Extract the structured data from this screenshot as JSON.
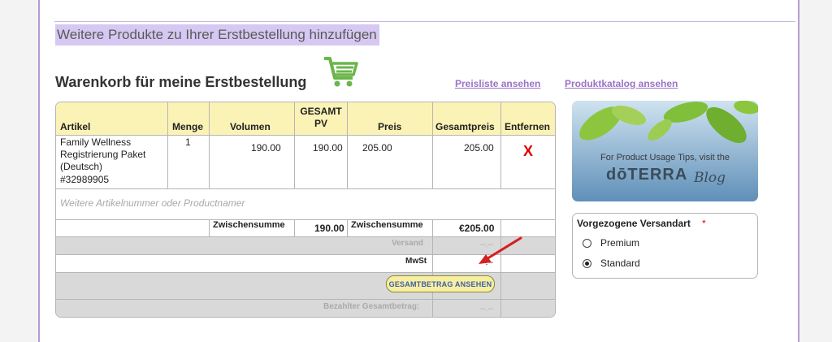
{
  "header": {
    "more_products_link": "Weitere Produkte zu Ihrer Erstbestellung hinzufügen",
    "cart_title": "Warenkorb für meine Erstbestellung",
    "links": [
      "Preisliste ansehen",
      "Produktkatalog ansehen"
    ]
  },
  "table": {
    "columns": [
      "Artikel",
      "Menge",
      "Volumen",
      "GESAMT",
      "PV",
      "Preis",
      "Gesamtpreis",
      "Entfernen"
    ],
    "rows": [
      {
        "article_lines": [
          "Family Wellness",
          "Registrierung Paket",
          "(Deutsch)",
          "#32989905"
        ],
        "quantity": "1",
        "volume": "190.00",
        "total_pv": "190.00",
        "price": "205.00",
        "total_price": "205.00",
        "remove": "X"
      }
    ],
    "add_placeholder": "Weitere Artikelnummer oder Productnamer",
    "subtotal_label_1": "Zwischensumme",
    "subtotal_pv": "190.00",
    "subtotal_label_2": "Zwischensumme",
    "subtotal_value": "€205.00",
    "shipping_label": "Versand",
    "shipping_value": "--.--",
    "vat_label": "MwSt",
    "vat_value": "--.--",
    "total_button": "GESAMTBETRAG ANSEHEN",
    "paid_label": "Bezahlter Gesamtbetrag:",
    "paid_value": "--.--"
  },
  "blog_banner": {
    "line1": "For Product Usage Tips, visit the",
    "brand": "dōTERRA",
    "script": "Blog"
  },
  "shipping": {
    "title": "Vorgezogene Versandart",
    "required_mark": "*",
    "options": [
      {
        "label": "Premium",
        "selected": false
      },
      {
        "label": "Standard",
        "selected": true
      }
    ]
  },
  "colors": {
    "accent_purple": "#9a72c5",
    "header_yellow": "#fbf3b6",
    "remove_red": "#e00000",
    "cart_green": "#6bb64a"
  }
}
